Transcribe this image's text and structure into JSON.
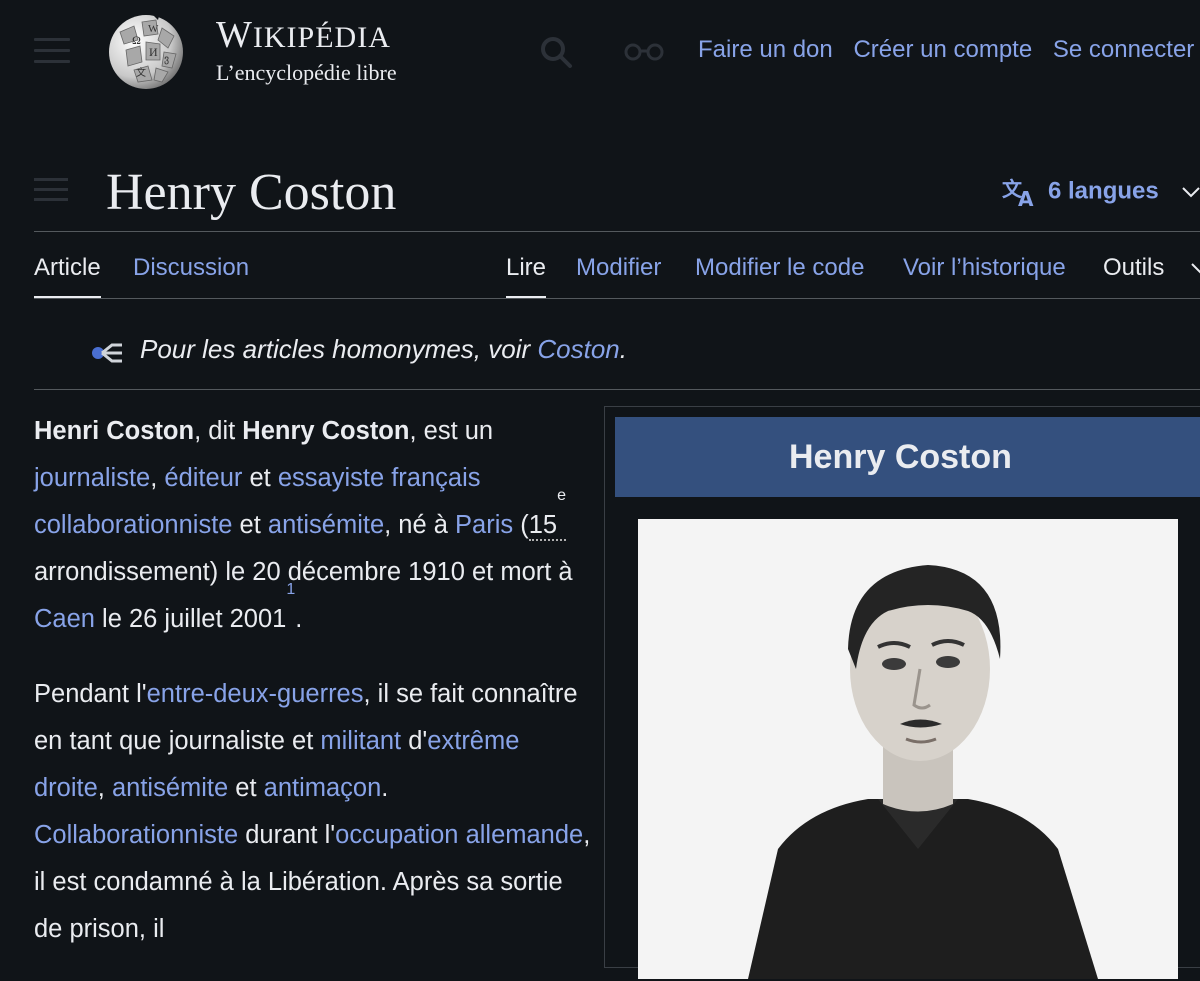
{
  "header": {
    "wordmark_title": "WIKIPÉDIA",
    "wordmark_title_parts": [
      "W",
      "IKIPÉDI",
      "A"
    ],
    "wordmark_tagline": "L’encyclopédie libre",
    "user_links": [
      "Faire un don",
      "Créer un compte",
      "Se connecter"
    ]
  },
  "page": {
    "title": "Henry Coston",
    "languages_label": "6 langues"
  },
  "tabs": {
    "left": [
      "Article",
      "Discussion"
    ],
    "right": [
      "Lire",
      "Modifier",
      "Modifier le code",
      "Voir l’historique",
      "Outils"
    ]
  },
  "hatnote": {
    "text": "Pour les articles homonymes, voir ",
    "link": "Coston",
    "end": "."
  },
  "paragraph1": {
    "bold1": "Henri Coston",
    "t1": ", dit ",
    "bold2": "Henry Coston",
    "t2": ", est un ",
    "l_journaliste": "journaliste",
    "t3": ", ",
    "l_editeur": "éditeur",
    "t4": " et ",
    "l_essayiste": "essayiste",
    "t5": " ",
    "l_francais": "français",
    "t6": " ",
    "l_collab": "collaborationniste",
    "t7": " et ",
    "l_antisemite": "antisémite",
    "t8": ", né à ",
    "l_paris": "Paris",
    "t9": " (",
    "arr_num": "15",
    "arr_sup": "e",
    "t10": " arrondissement) le 20 décembre 1910 et mort à ",
    "l_caen": "Caen",
    "t11": " le 26 juillet 2001",
    "ref": "1",
    "t12": "."
  },
  "paragraph2": {
    "t1": "Pendant l'",
    "l_entre": "entre-deux-guerres",
    "t2": ", il se fait connaître en tant que journaliste et ",
    "l_militant": "militant",
    "t3": " d'",
    "l_extreme": "extrême droite",
    "t4": ", ",
    "l_antisemite": "antisémite",
    "t5": " et ",
    "l_antimacon": "antimaçon",
    "t6": ". ",
    "l_collab": "Collaborationniste",
    "t7": " durant l'",
    "l_occupation": "occupation allemande",
    "t8": ", il est condamné à la Libération. Après sa sortie de prison, il"
  },
  "infobox": {
    "title": "Henry Coston"
  },
  "colors": {
    "background": "#101418",
    "text": "#eaecf0",
    "link": "#88a3e8",
    "infobox_header": "#34507e",
    "rule": "#54595d"
  },
  "icons": [
    "menu-icon",
    "wikipedia-globe-logo",
    "search-icon",
    "glasses-icon",
    "toc-icon",
    "translate-icon",
    "chevron-down-icon",
    "disambiguation-icon"
  ]
}
